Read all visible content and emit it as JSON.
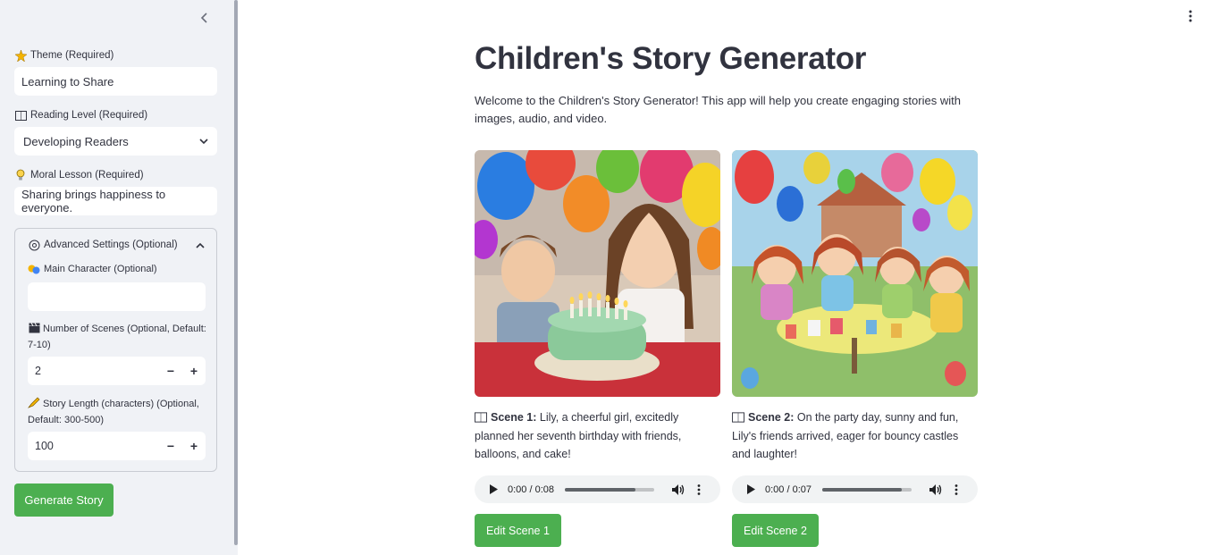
{
  "sidebar": {
    "theme": {
      "label": "Theme (Required)",
      "value": "Learning to Share"
    },
    "reading_level": {
      "label": "Reading Level (Required)",
      "value": "Developing Readers"
    },
    "moral": {
      "label": "Moral Lesson (Required)",
      "value": "Sharing brings happiness to everyone."
    },
    "advanced": {
      "label": "Advanced Settings (Optional)",
      "main_character": {
        "label": "Main Character (Optional)",
        "value": ""
      },
      "scenes": {
        "label": "Number of Scenes (Optional, Default: 7-10)",
        "value": "2"
      },
      "story_length": {
        "label": "Story Length (characters) (Optional, Default: 300-500)",
        "value": "100"
      }
    },
    "generate_label": "Generate Story"
  },
  "main": {
    "title": "Children's Story Generator",
    "intro": "Welcome to the Children's Story Generator! This app will help you create engaging stories with images, audio, and video.",
    "scenes": [
      {
        "heading": "Scene 1:",
        "text": " Lily, a cheerful girl, excitedly planned her seventh birthday with friends, balloons, and cake!",
        "audio_time": "0:00 / 0:08",
        "audio_progress": 0.79,
        "edit_label": "Edit Scene 1"
      },
      {
        "heading": "Scene 2:",
        "text": " On the party day, sunny and fun, Lily's friends arrived, eager for bouncy castles and laughter!",
        "audio_time": "0:00 / 0:07",
        "audio_progress": 0.89,
        "edit_label": "Edit Scene 2"
      }
    ]
  },
  "colors": {
    "accent": "#4caf50",
    "sidebar_bg": "#f0f2f6",
    "text": "#31333f"
  }
}
